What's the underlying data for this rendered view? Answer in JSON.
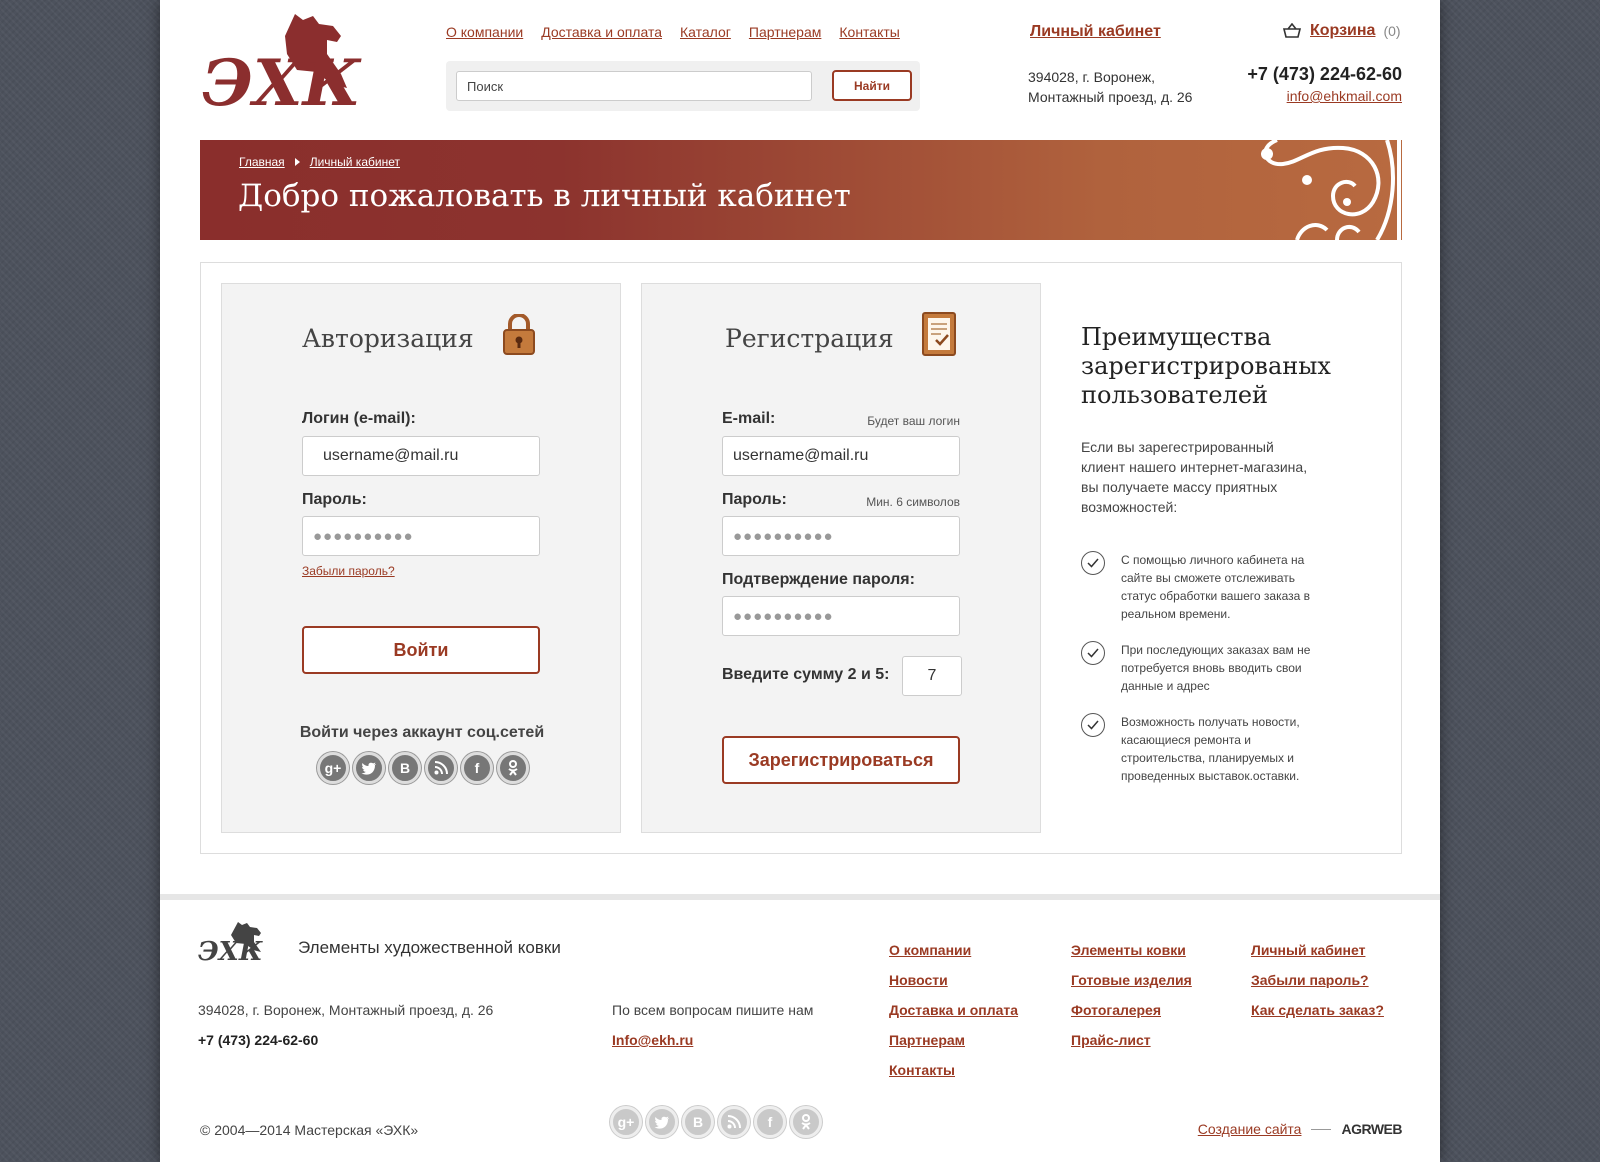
{
  "header": {
    "nav": [
      "О компании",
      "Доставка и оплата",
      "Каталог",
      "Партнерам",
      "Контакты"
    ],
    "search_placeholder": "Поиск",
    "search_button": "Найти",
    "cabinet_link": "Личный кабинет",
    "cart_label": "Корзина",
    "cart_count": "(0)",
    "address_line1": "394028, г. Воронеж,",
    "address_line2": "Монтажный проезд, д. 26",
    "phone": "+7 (473) 224-62-60",
    "email": "info@ehkmail.com",
    "logo_text": "ЭХК"
  },
  "banner": {
    "breadcrumbs": [
      "Главная",
      "Личный кабинет"
    ],
    "title": "Добро пожаловать в личный кабинет"
  },
  "login": {
    "title": "Авторизация",
    "login_label": "Логин (e-mail):",
    "login_value": "username@mail.ru",
    "password_label": "Пароль:",
    "password_value": "●●●●●●●●●●",
    "forgot": "Забыли пароль?",
    "submit": "Войти",
    "social_label": "Войти через аккаунт соц.сетей"
  },
  "register": {
    "title": "Регистрация",
    "email_label": "E-mail:",
    "email_hint": "Будет ваш логин",
    "email_value": "username@mail.ru",
    "password_label": "Пароль:",
    "password_hint": "Мин. 6 символов",
    "password_value": "●●●●●●●●●●",
    "confirm_label": "Подтверждение пароля:",
    "confirm_value": "●●●●●●●●●●",
    "captcha_label": "Введите сумму 2 и 5:",
    "captcha_value": "7",
    "submit": "Зарегистрироваться"
  },
  "advantages": {
    "title": "Преимущества зарегистрированых пользователей",
    "intro": "Если вы зарегестрированный клиент нашего интернет-магазина, вы получаете массу приятных возможностей:",
    "items": [
      "С помощью личного кабинета на сайте вы сможете отслеживать статус обработки вашего заказа в реальном времени.",
      "При последующих заказах вам не потребуется вновь вводить свои данные и адрес",
      "Возможность получать новости, касающиеся ремонта и строительства, планируемых и проведенных выставок.оставки."
    ]
  },
  "social_icons": [
    "g+",
    "twitter",
    "В",
    "rss",
    "f",
    "ok"
  ],
  "footer": {
    "tagline": "Элементы художественной ковки",
    "address": "394028, г. Воронеж, Монтажный проезд, д. 26",
    "phone": "+7 (473) 224-62-60",
    "ask": "По всем вопросам пишите нам",
    "email": "Info@ekh.ru",
    "col1": [
      "О компании",
      "Новости",
      "Доставка и оплата",
      "Партнерам",
      "Контакты"
    ],
    "col2": [
      "Элементы ковки",
      "Готовые изделия",
      "Фотогалерея",
      "Прайс-лист"
    ],
    "col3": [
      "Личный кабинет",
      "Забыли пароль?",
      "Как сделать заказ?"
    ],
    "copyright": "© 2004—2014 Мастерская «ЭХК»",
    "made_by": "Создание сайта",
    "agency": "AGRWEB"
  },
  "colors": {
    "accent": "#9a3a23",
    "banner_start": "#8a2e2c",
    "banner_end": "#b86a40"
  }
}
